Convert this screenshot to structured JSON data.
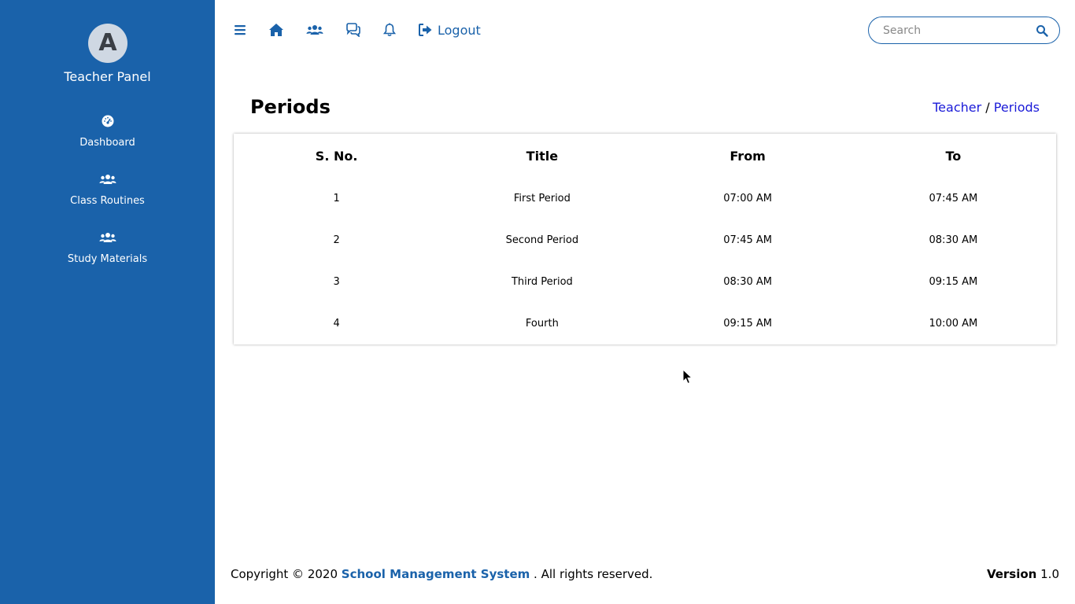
{
  "sidebar": {
    "avatar_letter": "A",
    "panel_title": "Teacher Panel",
    "items": [
      {
        "label": "Dashboard",
        "icon": "tachometer-icon"
      },
      {
        "label": "Class Routines",
        "icon": "users-icon"
      },
      {
        "label": "Study Materials",
        "icon": "users-icon"
      }
    ]
  },
  "topnav": {
    "icons": [
      "menu-icon",
      "home-icon",
      "users-icon",
      "comments-icon",
      "bell-icon"
    ],
    "logout_label": "Logout",
    "search_placeholder": "Search"
  },
  "page": {
    "title": "Periods",
    "breadcrumb": {
      "parent": "Teacher",
      "separator": "/",
      "current": "Periods"
    }
  },
  "table": {
    "headers": [
      "S. No.",
      "Title",
      "From",
      "To"
    ],
    "rows": [
      [
        "1",
        "First Period",
        "07:00 AM",
        "07:45 AM"
      ],
      [
        "2",
        "Second Period",
        "07:45 AM",
        "08:30 AM"
      ],
      [
        "3",
        "Third Period",
        "08:30 AM",
        "09:15 AM"
      ],
      [
        "4",
        "Fourth",
        "09:15 AM",
        "10:00 AM"
      ]
    ]
  },
  "footer": {
    "copyright_prefix": "Copyright © 2020",
    "brand": "School Management System",
    "suffix": ". All rights reserved.",
    "version_label": "Version",
    "version_value": "1.0"
  },
  "colors": {
    "sidebar_bg": "#1a62aa",
    "accent": "#1a62aa",
    "breadcrumb_link": "#1a1ad8"
  }
}
